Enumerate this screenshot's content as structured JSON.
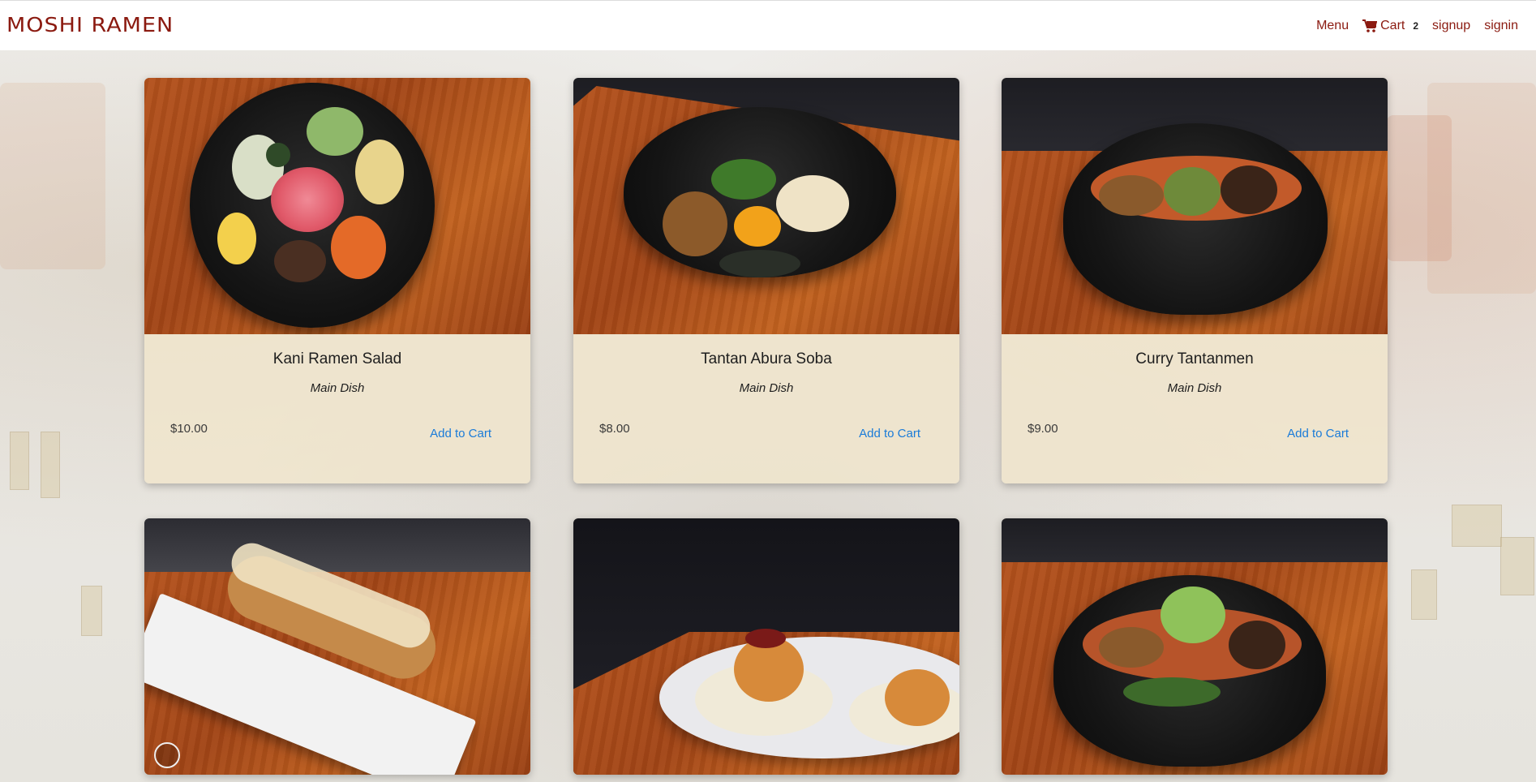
{
  "brand": {
    "logo_text": "MOSHI RAMEN"
  },
  "nav": {
    "menu_label": "Menu",
    "cart_label": "Cart",
    "cart_count": "2",
    "signup_label": "signup",
    "signin_label": "signin"
  },
  "colors": {
    "brand": "#8b1a10",
    "link": "#1a7bd8"
  },
  "products": [
    {
      "name": "Kani Ramen Salad",
      "category": "Main Dish",
      "price": "$10.00",
      "action": "Add to Cart"
    },
    {
      "name": "Tantan Abura Soba",
      "category": "Main Dish",
      "price": "$8.00",
      "action": "Add to Cart"
    },
    {
      "name": "Curry Tantanmen",
      "category": "Main Dish",
      "price": "$9.00",
      "action": "Add to Cart"
    },
    {
      "name": "",
      "category": "",
      "price": "",
      "action": ""
    },
    {
      "name": "",
      "category": "",
      "price": "",
      "action": ""
    },
    {
      "name": "",
      "category": "",
      "price": "",
      "action": ""
    }
  ]
}
